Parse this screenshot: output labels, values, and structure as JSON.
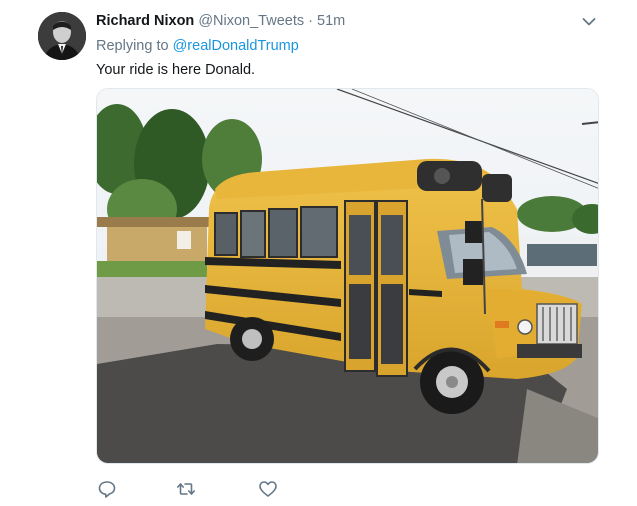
{
  "tweet": {
    "author": {
      "display_name": "Richard Nixon",
      "handle": "@Nixon_Tweets"
    },
    "separator": "·",
    "time": "51m",
    "reply_prefix": "Replying to",
    "reply_to": "@realDonaldTrump",
    "text": "Your ride is here Donald.",
    "media": {
      "subject": "yellow short school bus parked in a lot"
    }
  },
  "icons": {
    "caret": "chevron-down-icon",
    "reply": "reply-icon",
    "retweet": "retweet-icon",
    "like": "heart-icon"
  },
  "colors": {
    "link": "#1b95e0",
    "secondary_text": "#657786",
    "primary_text": "#14171a",
    "bus_yellow": "#e8b63a"
  }
}
